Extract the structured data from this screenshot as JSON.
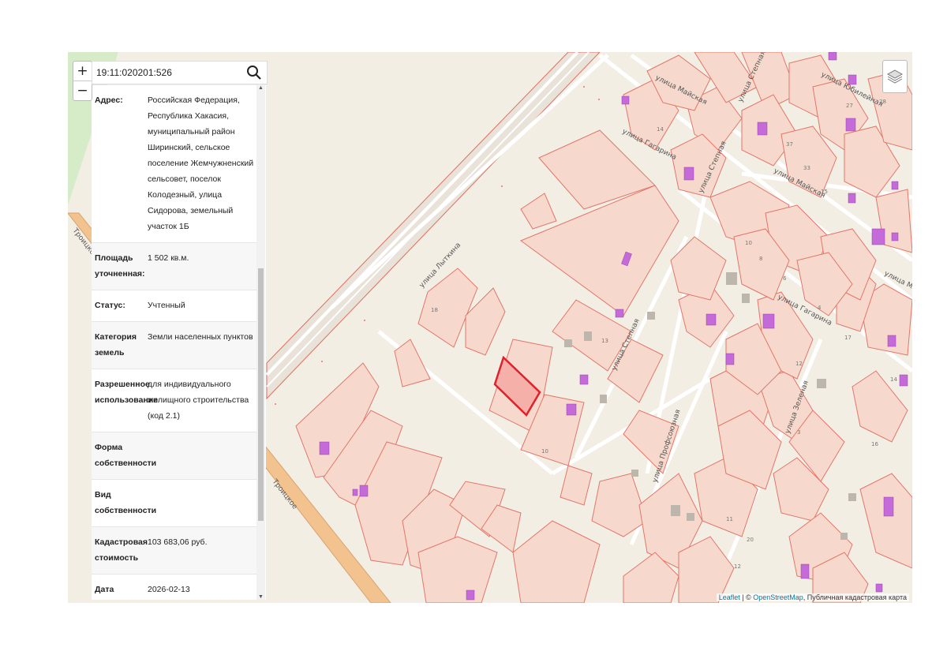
{
  "zoom": {
    "in_label": "+",
    "out_label": "−"
  },
  "search": {
    "value": "19:11:020201:526",
    "icon": "magnifier-icon"
  },
  "info": {
    "rows": [
      {
        "label": "Адрес:",
        "value": "Российская Федерация, Республика Хакасия, муниципальный район Ширинский, сельское поселение Жемчужненский сельсовет, поселок Колодезный, улица Сидорова, земельный участок 1Б"
      },
      {
        "label": "Площадь уточненная:",
        "value": "1 502 кв.м."
      },
      {
        "label": "Статус:",
        "value": "Учтенный"
      },
      {
        "label": "Категория земель",
        "value": "Земли населенных пунктов"
      },
      {
        "label": "Разрешенное использование",
        "value": "для индивидуального жилищного строительства (код 2.1)"
      },
      {
        "label": "Форма собственности",
        "value": ""
      },
      {
        "label": "Вид собственности",
        "value": ""
      },
      {
        "label": "Кадастровая стоимость",
        "value": "103 683,06 руб."
      },
      {
        "label": "Дата применения",
        "value": "2026-02-13"
      }
    ]
  },
  "map": {
    "streets": [
      "улица Майская",
      "улица Степная",
      "улица Юбилейная",
      "улица Гагарина",
      "улица Степная",
      "улица Майская",
      "улица Лыткина",
      "улица Гагарина",
      "улица Майская",
      "улица Степная",
      "улица Профсоюзная",
      "улица Зеленая",
      "Троицкое",
      "Троицкое"
    ],
    "house_numbers": [
      "18",
      "13",
      "10",
      "14",
      "33",
      "37",
      "27",
      "28",
      "15",
      "17",
      "10",
      "8",
      "12",
      "14",
      "16",
      "20",
      "12",
      "11",
      "4",
      "6",
      "3"
    ],
    "colors": {
      "background": "#f3eee4",
      "parcel_fill": "#f6d9cc",
      "parcel_stroke": "#e2766a",
      "building": "#c56ad9",
      "selected": "#e0202a"
    }
  },
  "layers_icon": "layers-icon",
  "attribution": {
    "leaflet": "Leaflet",
    "sep": " | © ",
    "osm": "OpenStreetMap",
    "rest": ", Публичная кадастровая карта"
  }
}
